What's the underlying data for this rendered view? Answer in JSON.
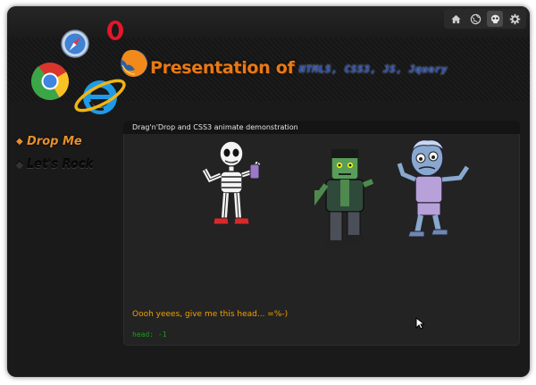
{
  "header": {
    "title": "Presentation of",
    "subtitle": "HTML5, CSS3, JS, Jquery",
    "browsers": [
      "chrome-logo",
      "safari-logo",
      "opera-logo",
      "firefox-logo",
      "internet-explorer-logo"
    ]
  },
  "toolbar": {
    "items": [
      {
        "icon": "home-icon"
      },
      {
        "icon": "globe-icon"
      },
      {
        "icon": "skull-icon",
        "active": true
      },
      {
        "icon": "gear-icon"
      }
    ]
  },
  "sidebar": {
    "items": [
      {
        "label": "Drop Me",
        "active": true
      },
      {
        "label": "Let's Rock",
        "active": false
      }
    ]
  },
  "panel": {
    "title": "Drag'n'Drop and CSS3 animate demonstration",
    "characters": [
      "skeleton",
      "frankenstein",
      "zombie"
    ],
    "message": "Oooh yeees, give me this head... =%-)",
    "console": "head: -1"
  },
  "colors": {
    "accent": "#e8902b",
    "background": "#1a1a1a",
    "console_green": "#19a019",
    "message_orange": "#f0a000"
  }
}
